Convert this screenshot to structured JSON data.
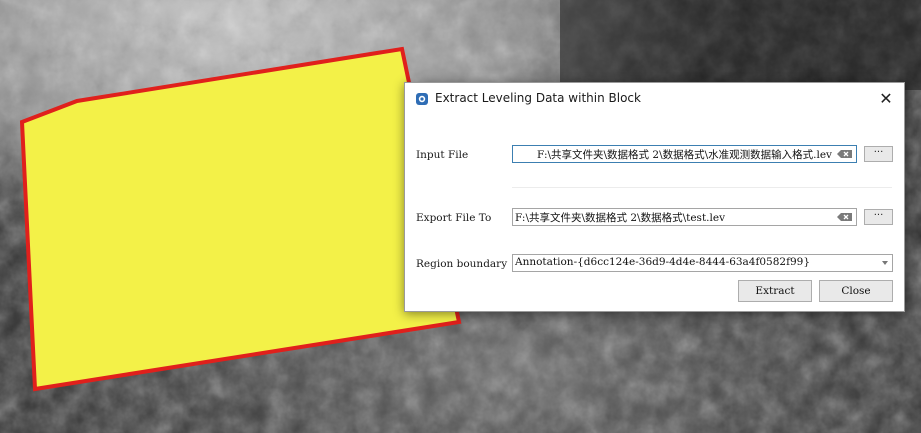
{
  "background": {
    "polygon_fill": "#f3f148",
    "polygon_stroke": "#e0201c"
  },
  "dialog": {
    "title": "Extract Leveling Data within Block",
    "icon": "app-icon",
    "close_symbol": "✕",
    "input_file": {
      "label": "Input File",
      "value": "F:\\共享文件夹\\数据格式 2\\数据格式\\水准观测数据输入格式.lev",
      "browse_label": "···"
    },
    "export_file": {
      "label": "Export File To",
      "value": "F:\\共享文件夹\\数据格式 2\\数据格式\\test.lev",
      "browse_label": "···"
    },
    "region_boundary": {
      "label": "Region boundary",
      "value": "Annotation-{d6cc124e-36d9-4d4e-8444-63a4f0582f99}"
    },
    "buttons": {
      "extract": "Extract",
      "close": "Close"
    }
  }
}
